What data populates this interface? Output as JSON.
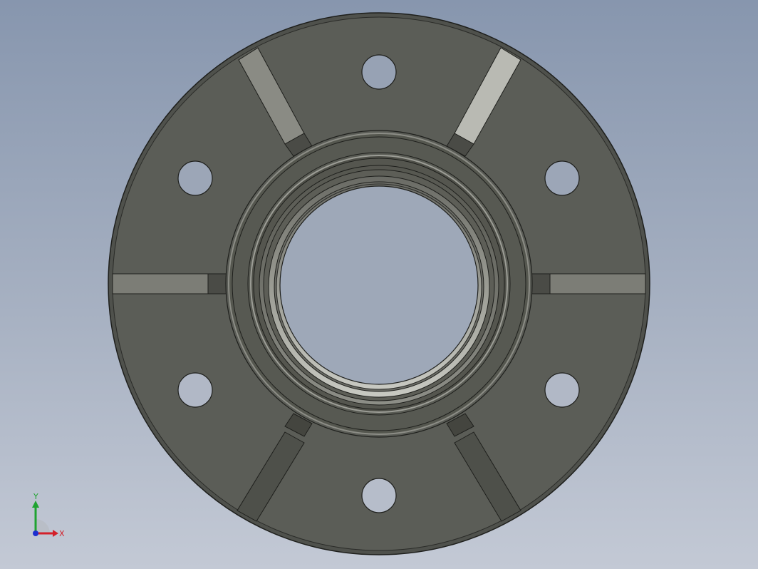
{
  "viewport": {
    "background_top": "#8796ae",
    "background_bottom": "#c3c9d5"
  },
  "model": {
    "face_color": "#5b5d57",
    "edge_color": "#1e1f1c",
    "rib_light_color": "#7c7d76",
    "rib_bright_color": "#b9bab3",
    "bolt_hole_count": 6
  },
  "triad": {
    "x_label": "X",
    "y_label": "Y",
    "x_color": "#d3202a",
    "y_color": "#1fa331",
    "z_color": "#1d2ed0"
  }
}
